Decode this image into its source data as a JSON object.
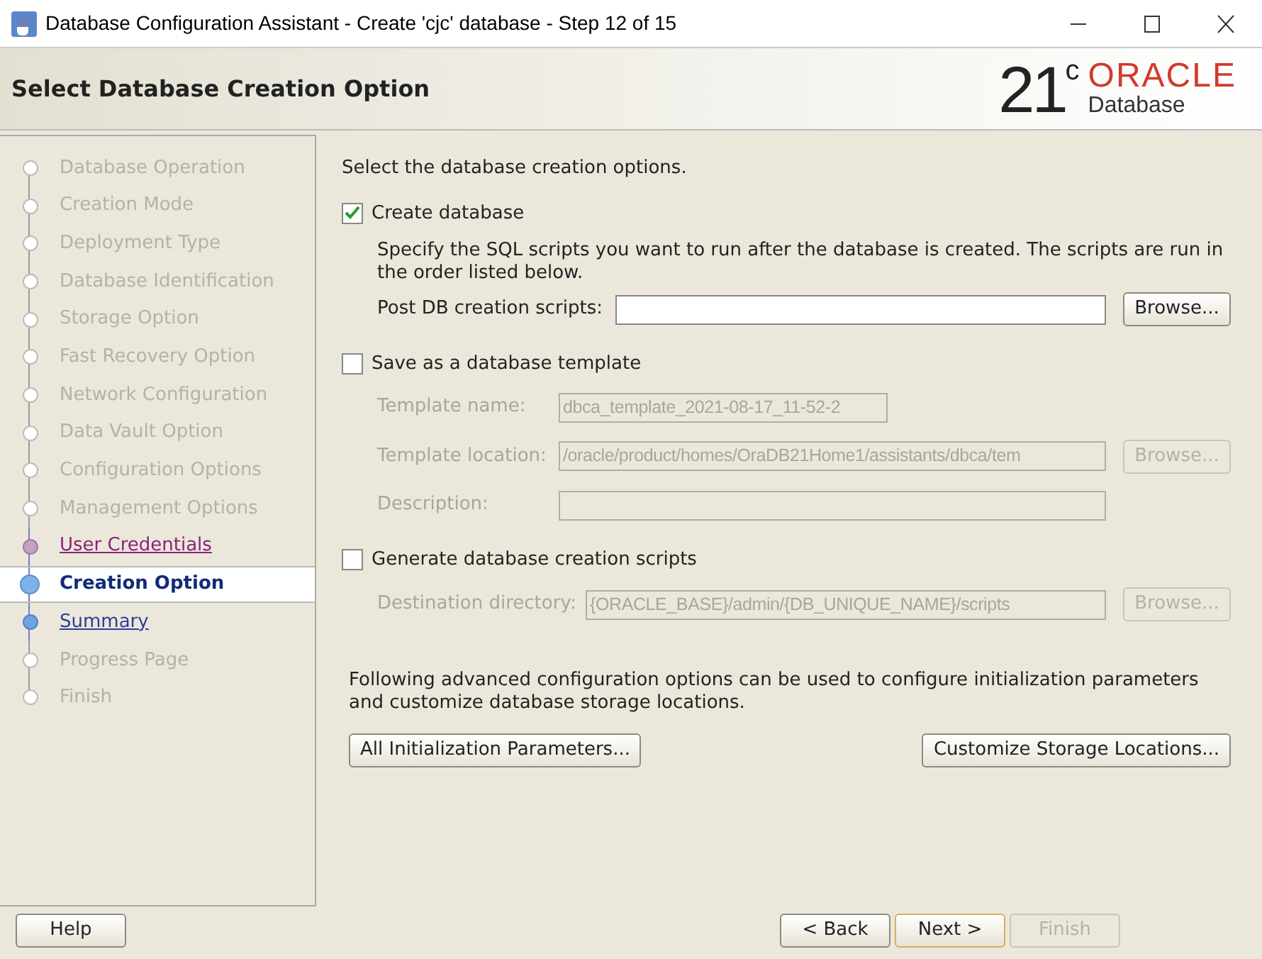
{
  "window": {
    "title": "Database Configuration Assistant - Create 'cjc' database - Step 12 of 15"
  },
  "header": {
    "title": "Select Database Creation Option",
    "logo_version": "21",
    "logo_superscript": "c",
    "logo_brand": "ORACLE",
    "logo_product": "Database"
  },
  "steps": [
    {
      "label": "Database Operation",
      "kind": "past",
      "selected": false
    },
    {
      "label": "Creation Mode",
      "kind": "past",
      "selected": false
    },
    {
      "label": "Deployment Type",
      "kind": "past",
      "selected": false
    },
    {
      "label": "Database Identification",
      "kind": "past",
      "selected": false
    },
    {
      "label": "Storage Option",
      "kind": "past",
      "selected": false
    },
    {
      "label": "Fast Recovery Option",
      "kind": "past",
      "selected": false
    },
    {
      "label": "Network Configuration",
      "kind": "past",
      "selected": false
    },
    {
      "label": "Data Vault Option",
      "kind": "past",
      "selected": false
    },
    {
      "label": "Configuration Options",
      "kind": "past",
      "selected": false
    },
    {
      "label": "Management Options",
      "kind": "past",
      "selected": false
    },
    {
      "label": "User Credentials",
      "kind": "visited",
      "selected": false
    },
    {
      "label": "Creation Option",
      "kind": "current",
      "selected": true
    },
    {
      "label": "Summary",
      "kind": "link",
      "selected": false
    },
    {
      "label": "Progress Page",
      "kind": "pending",
      "selected": false
    },
    {
      "label": "Finish",
      "kind": "pending",
      "selected": false
    }
  ],
  "content": {
    "intro": "Select the database creation options.",
    "create_database": {
      "label": "Create database",
      "checked": true,
      "description": "Specify the SQL scripts you want to run after the database is created. The scripts are run in the order listed below.",
      "scripts_label": "Post DB creation scripts:",
      "browse": "Browse..."
    },
    "save_template": {
      "label": "Save as a database template",
      "checked": false,
      "fields": [
        {
          "label": "Template name:",
          "value": "dbca_template_2021-08-17_11-52-2",
          "kind": "short",
          "disabled": true
        },
        {
          "label": "Template location:",
          "value": "/oracle/product/homes/OraDB21Home1/assistants/dbca/tem",
          "kind": "browse",
          "browse": "Browse...",
          "disabled": true
        },
        {
          "label": "Description:",
          "kind": "long",
          "disabled": true
        }
      ]
    },
    "generate_scripts": {
      "label": "Generate database creation scripts",
      "checked": false,
      "field": {
        "label": "Destination directory:",
        "value": "{ORACLE_BASE}/admin/{DB_UNIQUE_NAME}/scripts",
        "browse": "Browse...",
        "disabled": true
      }
    },
    "advanced_text": "Following advanced configuration options can be used to configure initialization parameters and customize database storage locations.",
    "advanced_buttons": [
      "All Initialization Parameters...",
      "Customize Storage Locations..."
    ]
  },
  "footer": {
    "help": "Help",
    "buttons": [
      {
        "label": "< Back",
        "disabled": false,
        "default": false
      },
      {
        "label": "Next >",
        "disabled": false,
        "default": true
      },
      {
        "label": "Finish",
        "disabled": true,
        "default": false
      }
    ]
  }
}
